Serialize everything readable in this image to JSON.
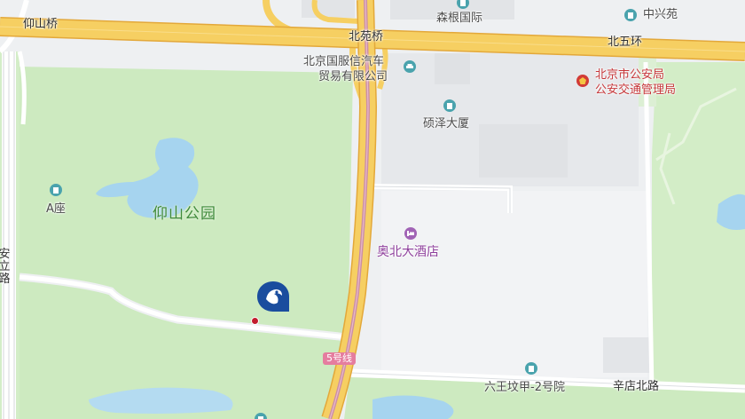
{
  "map": {
    "roads": {
      "bei_wu_huan": "北五环",
      "bei_yuan_qiao": "北苑桥",
      "yang_shan_qiao": "仰山桥",
      "xin_dian_bei_lu": "辛店北路",
      "an_li_lu": "安立路"
    },
    "parks": {
      "yang_shan": "仰山公园"
    },
    "pois": {
      "sen_gen": "森根国际",
      "zhong_xing_yuan": "中兴苑",
      "car_dealer_line1": "北京国服信汽车",
      "car_dealer_line2": "贸易有限公司",
      "police_line1": "北京市公安局",
      "police_line2": "公安交通管理局",
      "shuo_ze": "硕泽大厦",
      "a_zuo": "A座",
      "hotel": "奥北大酒店",
      "liu_wang_fen": "六王坟甲-2号院"
    },
    "metro_line": "5号线",
    "colors": {
      "park": "#cdeac0",
      "expressway": "#f6cf62",
      "metro": "#e57d9f",
      "building_icon": "#4aa3ad",
      "hotel_icon": "#a163b5",
      "gov_icon": "#d23b36",
      "marker": "#1a4d9e"
    },
    "icons": {
      "building": "building-icon",
      "car": "car-icon",
      "hotel": "bed-icon",
      "government": "emblem-icon",
      "marker": "location-marker-icon"
    }
  }
}
